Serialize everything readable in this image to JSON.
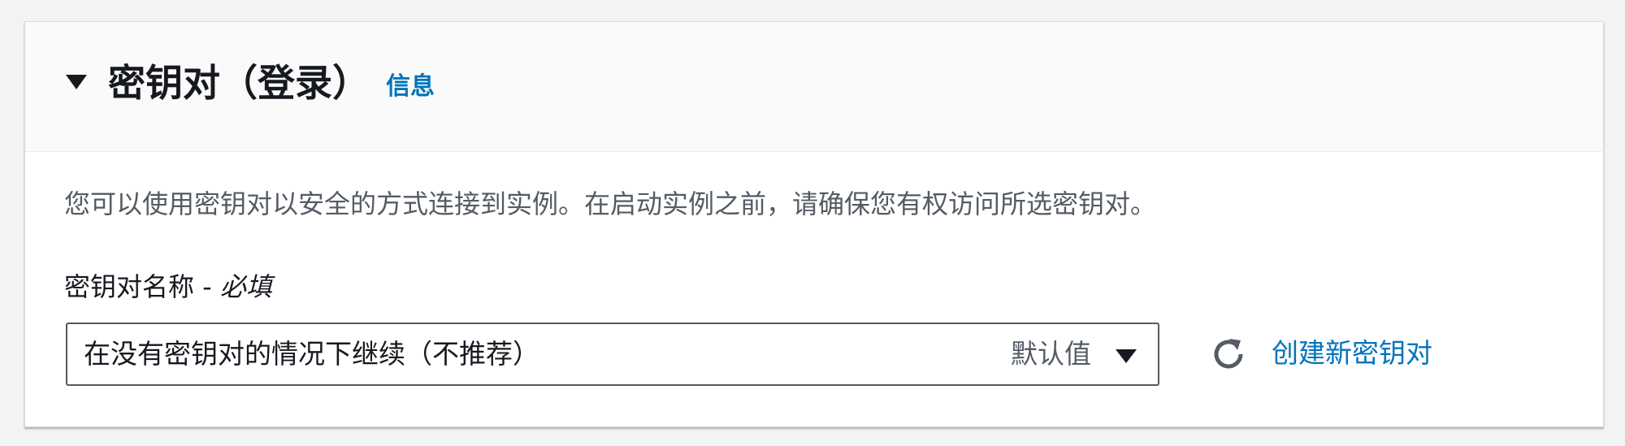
{
  "section": {
    "title": "密钥对（登录）",
    "info_link": "信息",
    "expanded": true,
    "description": "您可以使用密钥对以安全的方式连接到实例。在启动实例之前，请确保您有权访问所选密钥对。"
  },
  "key_pair_field": {
    "label": "密钥对名称 - ",
    "required_text": "必填",
    "selected_value": "在没有密钥对的情况下继续（不推荐）",
    "selected_tag": "默认值"
  },
  "actions": {
    "refresh_icon": "refresh-icon",
    "create_new_label": "创建新密钥对"
  },
  "colors": {
    "link": "#0073bb",
    "text_primary": "#16191f",
    "text_secondary": "#545b64",
    "page_background": "#f2f3f3",
    "header_background": "#fafafa"
  }
}
